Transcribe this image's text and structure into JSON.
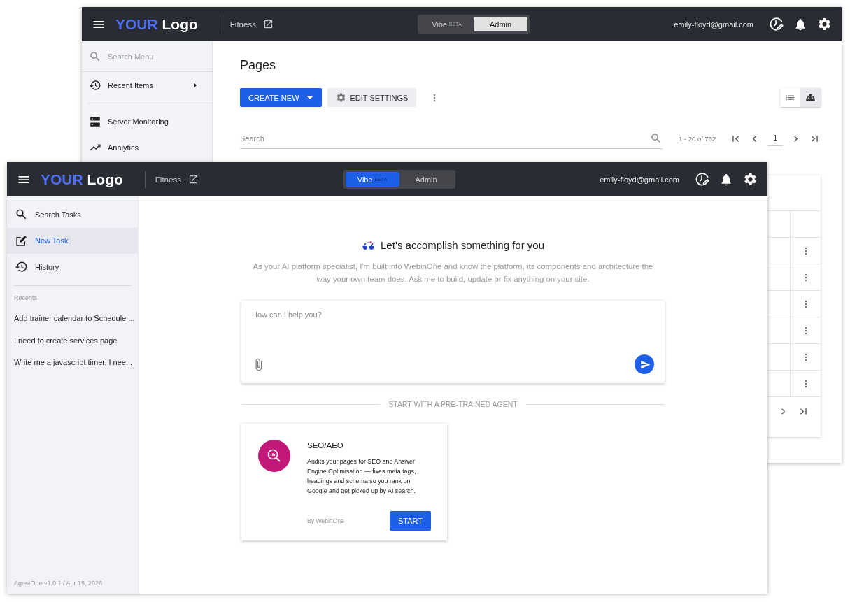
{
  "back_window": {
    "header": {
      "logo_accent": "YOUR",
      "logo_text": "Logo",
      "site": "Fitness",
      "modes": [
        {
          "label": "Vibe",
          "badge": "BETA",
          "selected": false
        },
        {
          "label": "Admin",
          "selected": true
        }
      ],
      "user": "emily-floyd@gmail.com"
    },
    "sidebar": {
      "search": {
        "placeholder": "Search Menu"
      },
      "items": [
        {
          "kind": "recent",
          "label": "Recent Items"
        },
        {
          "kind": "server",
          "label": "Server Monitoring"
        },
        {
          "kind": "analytics",
          "label": "Analytics"
        }
      ]
    },
    "page_title": "Pages",
    "buttons": [
      {
        "kind": "primary",
        "label": "CREATE NEW"
      },
      {
        "kind": "secondary",
        "label": "EDIT SETTINGS"
      }
    ],
    "view_toggle": [
      {
        "kind": "list",
        "selected": false
      },
      {
        "kind": "tree",
        "selected": true
      }
    ],
    "search": {
      "placeholder": "Search"
    },
    "pagination": {
      "range": "1 - 20 of 732",
      "page": "1"
    }
  },
  "front_window": {
    "header": {
      "logo_accent": "YOUR",
      "logo_text": "Logo",
      "site": "Fitness",
      "modes": [
        {
          "label": "Vibe",
          "badge": "BETA",
          "selected": true
        },
        {
          "label": "Admin",
          "selected": false
        }
      ],
      "user": "emily-floyd@gmail.com"
    },
    "sidebar": {
      "items": [
        {
          "kind": "search",
          "label": "Search Tasks",
          "selected": false
        },
        {
          "kind": "edit",
          "label": "New Task",
          "selected": true
        },
        {
          "kind": "history",
          "label": "History",
          "selected": false
        }
      ],
      "recents_heading": "Recents",
      "recents": [
        "Add trainer calendar to Schedule ...",
        "I need to create services page",
        "Write me a javascript timer, I nee..."
      ],
      "footer": "AgentOne v1.0.1 / Apr 15, 2026"
    },
    "hero": {
      "title": "Let’s accomplish something for you",
      "subtitle": "As your AI platform specialist, I'm built into WebinOne and know the platform, its components and architecture the way your own team does. Ask me to build, update or fix anything on your site."
    },
    "prompt": {
      "placeholder": "How can I help you?"
    },
    "divider_label": "START WITH A PRE-TRAINED AGENT",
    "agents": [
      {
        "title": "SEO/AEO",
        "description": "Audits your pages for SEO and Answer Engine Optimisation — fixes meta tags, headings and schema so you rank on Google and get picked up by AI search.",
        "author": "By WebinOne",
        "action": "START",
        "color": "#c2187a"
      }
    ]
  }
}
